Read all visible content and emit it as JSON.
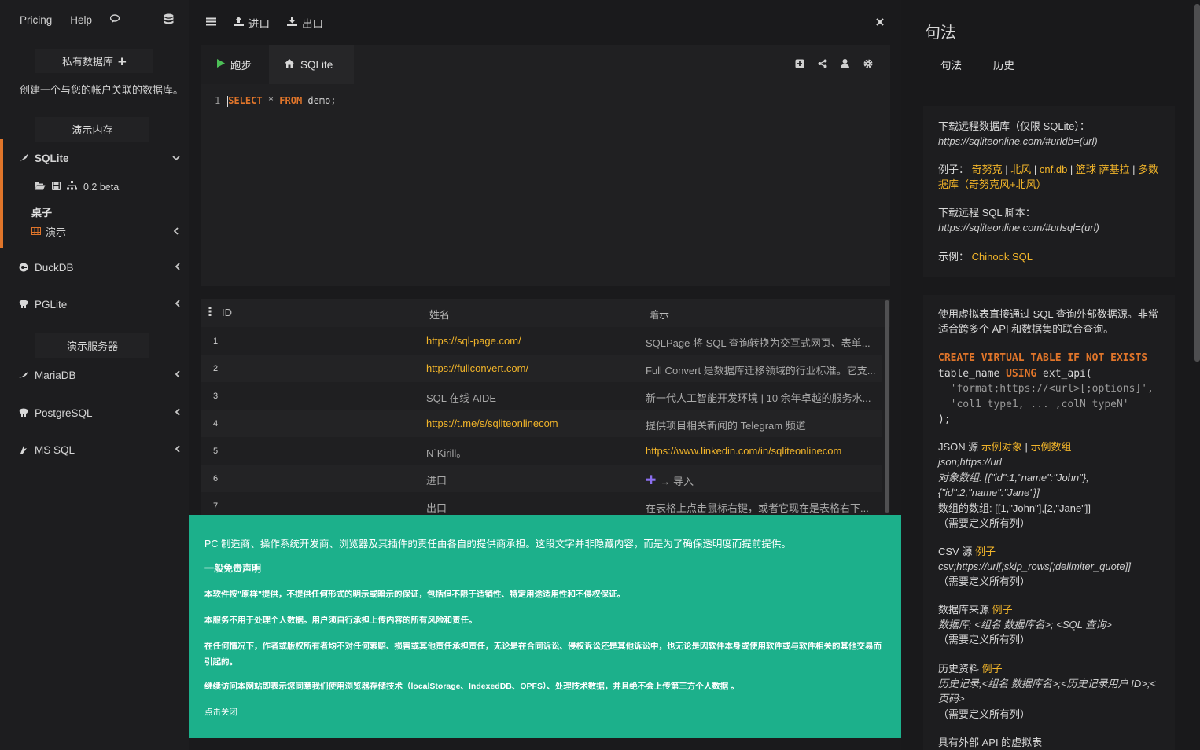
{
  "colors": {
    "accent": "#e0752a",
    "link": "#f2b52a",
    "banner": "#1cb08b",
    "run": "#4cbf56"
  },
  "sidebar": {
    "pricing": "Pricing",
    "help": "Help",
    "private_db": "私有数据库",
    "private_db_desc": "创建一个与您的帐户关联的数据库。",
    "demo_memory": "演示内存",
    "sqlite": "SQLite",
    "sqlite_version": "0.2 beta",
    "desk": "桌子",
    "demo_table": "演示",
    "duckdb": "DuckDB",
    "pglite": "PGLite",
    "demo_server": "演示服务器",
    "mariadb": "MariaDB",
    "postgresql": "PostgreSQL",
    "mssql": "MS SQL"
  },
  "topbar": {
    "import": "进口",
    "export": "出口"
  },
  "editor": {
    "run": "跑步",
    "db_tab": "SQLite",
    "line_no": "1",
    "kw_select": "SELECT",
    "star": " * ",
    "kw_from": "FROM",
    "table": " demo;"
  },
  "grid": {
    "columns": [
      "ID",
      "姓名",
      "暗示"
    ],
    "rows": [
      {
        "n": "1",
        "name": "https://sql-page.com/",
        "hint": "SQLPage 将 SQL 查询转换为交互式网页、表单..."
      },
      {
        "n": "2",
        "name": "https://fullconvert.com/",
        "hint": "Full Convert 是数据库迁移领域的行业标准。它支..."
      },
      {
        "n": "3",
        "name": "SQL 在线 AIDE",
        "hint": "新一代人工智能开发环境 | 10 余年卓越的服务水..."
      },
      {
        "n": "4",
        "name": "https://t.me/s/sqliteonlinecom",
        "hint": "提供项目相关新闻的 Telegram 频道"
      },
      {
        "n": "5",
        "name": "N`Kirill。",
        "hint": "https://www.linkedin.com/in/sqliteonlinecom"
      },
      {
        "n": "6",
        "name": "进口",
        "hint": "→ 导入"
      },
      {
        "n": "7",
        "name": "出口",
        "hint": "在表格上点击鼠标右键，或者它现在是表格右下..."
      }
    ]
  },
  "disclaimer": {
    "p1": "PC 制造商、操作系统开发商、浏览器及其插件的责任由各自的提供商承担。这段文字并非隐藏内容，而是为了确保透明度而提前提供。",
    "p2": "一般免责声明",
    "p3": "本软件按\"原样\"提供，不提供任何形式的明示或暗示的保证，包括但不限于适销性、特定用途适用性和不侵权保证。",
    "p4": "本服务不用于处理个人数据。用户须自行承担上传内容的所有风险和责任。",
    "p5": "在任何情况下，作者或版权所有者均不对任何索赔、损害或其他责任承担责任，无论是在合同诉讼、侵权诉讼还是其他诉讼中，也无论是因软件本身或使用软件或与软件相关的其他交易而引起的。",
    "p6": "继续访问本网站即表示您同意我们使用浏览器存储技术（localStorage、IndexedDB、OPFS）、处理技术数据，并且绝不会上传第三方个人数据 。",
    "close": "点击关闭"
  },
  "right": {
    "title": "句法",
    "tab_syntax": "句法",
    "tab_history": "历史",
    "card1": {
      "dl_remote": "下载远程数据库（仅限 SQLite）：",
      "dl_remote_url": "https://sqliteonline.com/#urldb=(url)",
      "examples_label": "例子：",
      "ex1": "奇努克",
      "sep": " | ",
      "ex2": "北风",
      "ex3": "cnf.db",
      "ex4": "篮球 萨基拉",
      "ex5": "多数据库（奇努克风+北风）",
      "dl_script": "下载远程 SQL 脚本：",
      "dl_script_url": "https://sqliteonline.com/#urlsql=(url)",
      "sample_label": "示例：",
      "sample": "Chinook SQL"
    },
    "card2": {
      "intro": "使用虚拟表直接通过 SQL 查询外部数据源。非常适合跨多个 API 和数据集的联合查询。",
      "code1": "CREATE VIRTUAL TABLE IF NOT EXISTS",
      "code2a": "table_name ",
      "code2b": "USING",
      "code2c": " ext_api(",
      "code3": "  'format;https://<url>[;options]',",
      "code4": "  'col1 type1, ... ,colN typeN'",
      "code5": ");",
      "json_label": "JSON 源",
      "json_ex1": "示例对象",
      "json_ex2": "示例数组",
      "json_fmt": "json;https://url",
      "obj_data": "对象数组: [{\"id\":1,\"name\":\"John\"}, {\"id\":2,\"name\":\"Jane\"}]",
      "arr_data": "数组的数组: [[1,\"John\"],[2,\"Jane\"]]",
      "need_cols": "（需要定义所有列）",
      "csv_label": "CSV 源",
      "example": "例子",
      "csv_fmt": "csv;https://url[;skip_rows[;delimiter_quote]]",
      "dbsrc_label": "数据库来源",
      "dbsrc_fmt": "数据库; <组名 数据库名>; <SQL 查询>",
      "hist_label": "历史资料",
      "hist_fmt": "历史记录;<组名 数据库名>;<历史记录用户 ID>;<页码>",
      "ext_api": "具有外部 API 的虚拟表"
    }
  }
}
